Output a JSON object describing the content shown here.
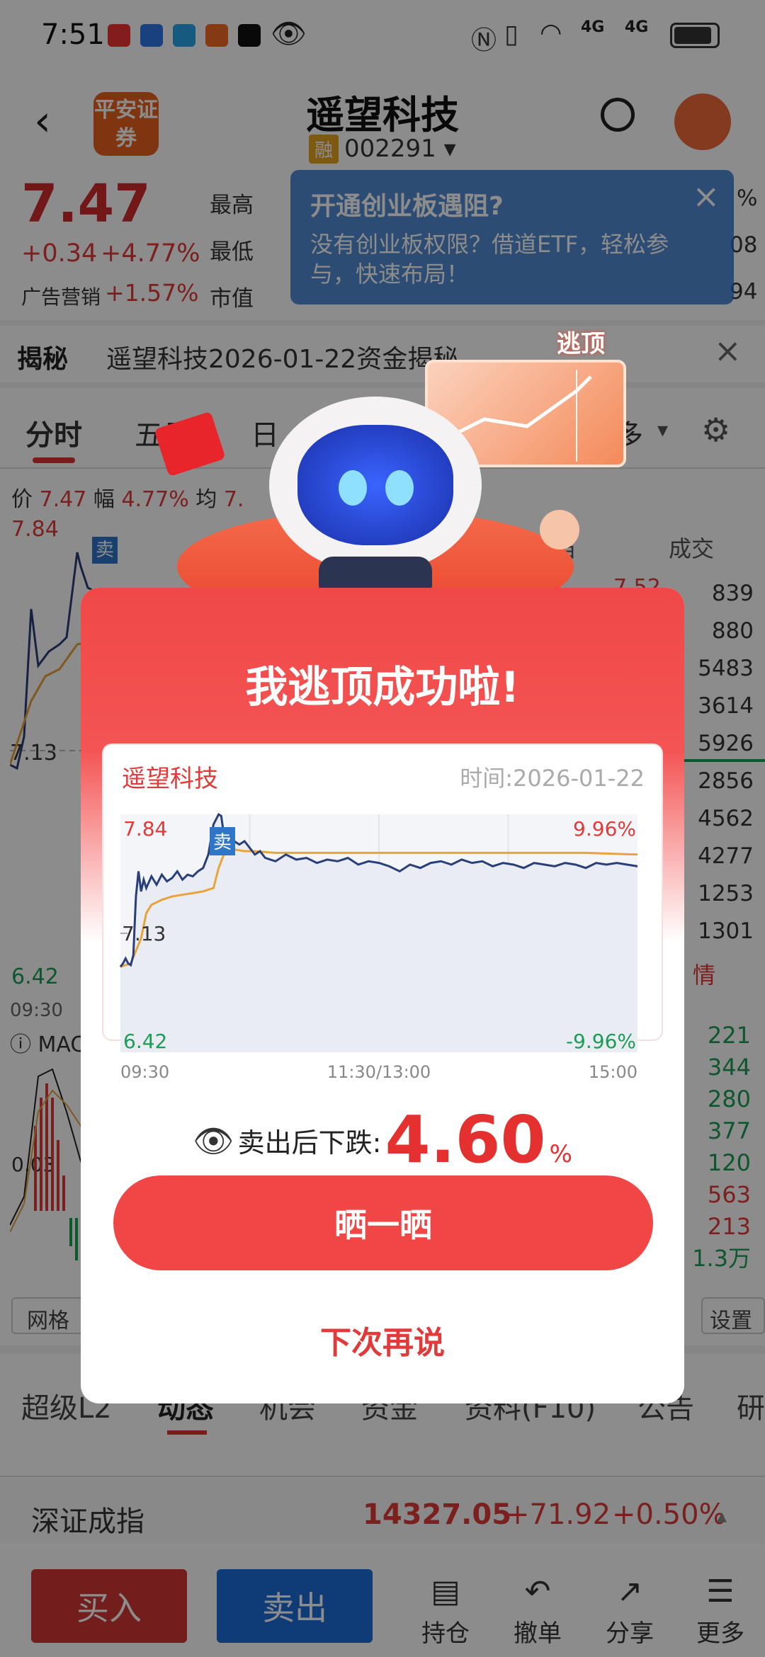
{
  "status": {
    "time": "7:51",
    "signal1": "4G",
    "signal2": "4G"
  },
  "header": {
    "logo_text": "平安证券",
    "stock_name": "遥望科技",
    "badge": "融",
    "code": "002291"
  },
  "quote": {
    "price": "7.47",
    "change": "+0.34",
    "change_pct": "+4.77%",
    "ad_label": "广告营销",
    "ad_pct": "+1.57%",
    "labels": [
      "最高",
      "最低",
      "市值"
    ],
    "right_col": [
      "%",
      "08",
      "94"
    ]
  },
  "notice": {
    "title": "开通创业板遇阻?",
    "body": "没有创业板权限？借道ETF，轻松参与，快速布局！",
    "close": "×"
  },
  "reveal": {
    "label": "揭秘",
    "text": "遥望科技2026-01-22资金揭秘",
    "close": "×"
  },
  "tabs": {
    "items": [
      "分时",
      "五日",
      "日"
    ],
    "more": "多"
  },
  "minibar": {
    "price_label": "价",
    "price": "7.47",
    "amp_label": "幅",
    "amp": "4.77%",
    "avg_label": "均",
    "avg": "7."
  },
  "bg_chart": {
    "top": "7.84",
    "mid": "7.13",
    "bottom": "6.42",
    "time": "09:30",
    "macd": "MAC",
    "macd_val": "0.03",
    "sell_mark": "卖",
    "grid_btn": "网格",
    "set_btn": "设置"
  },
  "orderbook": {
    "headers": [
      "档",
      "成交"
    ],
    "partial_price": "7.52",
    "vols": [
      "839",
      "880",
      "5483",
      "3614",
      "5926",
      "2856",
      "4562",
      "4277",
      "1253",
      "1301"
    ],
    "link": "情"
  },
  "right_nums": [
    "221",
    "344",
    "280",
    "377",
    "120",
    "563",
    "213",
    "1.3万"
  ],
  "bottom_tabs": [
    "超级L2",
    "动态",
    "机会",
    "资金",
    "资料(F10)",
    "公告",
    "研"
  ],
  "index": {
    "name": "深证成指",
    "value": "14327.05",
    "change": "+71.92",
    "pct": "+0.50%"
  },
  "actions": {
    "buy": "买入",
    "sell": "卖出",
    "tools": [
      "持仓",
      "撤单",
      "分享",
      "更多"
    ]
  },
  "banner": {
    "tag": "逃顶"
  },
  "modal": {
    "title": "我逃顶成功啦!",
    "card_name": "遥望科技",
    "card_time": "时间:2026-01-22",
    "share_btn": "晒一晒",
    "later_btn": "下次再说",
    "result_label": "卖出后下跌:",
    "result_value": "4.60",
    "result_unit": "%"
  },
  "chart_data": {
    "type": "line",
    "title": "",
    "ylim": [
      6.42,
      7.84
    ],
    "y_left_labels": [
      "7.84",
      "7.13",
      "6.42"
    ],
    "y_right_labels": [
      "9.96%",
      "-9.96%"
    ],
    "x_labels": [
      "09:30",
      "11:30/13:00",
      "15:00"
    ],
    "sell_marker": {
      "label": "卖",
      "x": 0.2
    },
    "series": [
      {
        "color": "#2a3f7a",
        "x": [
          0,
          0.005,
          0.01,
          0.015,
          0.02,
          0.025,
          0.03,
          0.035,
          0.04,
          0.045,
          0.05,
          0.06,
          0.07,
          0.08,
          0.09,
          0.1,
          0.11,
          0.12,
          0.13,
          0.14,
          0.15,
          0.16,
          0.17,
          0.18,
          0.19,
          0.195,
          0.2,
          0.205,
          0.21,
          0.22,
          0.23,
          0.24,
          0.25,
          0.26,
          0.27,
          0.28,
          0.3,
          0.32,
          0.34,
          0.36,
          0.38,
          0.4,
          0.42,
          0.44,
          0.46,
          0.48,
          0.5,
          0.52,
          0.54,
          0.56,
          0.58,
          0.6,
          0.62,
          0.64,
          0.66,
          0.68,
          0.7,
          0.72,
          0.74,
          0.76,
          0.78,
          0.8,
          0.82,
          0.84,
          0.86,
          0.88,
          0.9,
          0.92,
          0.94,
          0.96,
          0.98,
          1.0
        ],
        "y": [
          6.93,
          6.95,
          6.98,
          6.95,
          6.94,
          7.0,
          7.35,
          7.5,
          7.38,
          7.45,
          7.4,
          7.47,
          7.42,
          7.48,
          7.44,
          7.46,
          7.5,
          7.45,
          7.48,
          7.47,
          7.5,
          7.52,
          7.6,
          7.78,
          7.84,
          7.83,
          7.72,
          7.7,
          7.72,
          7.68,
          7.66,
          7.68,
          7.64,
          7.6,
          7.62,
          7.58,
          7.56,
          7.6,
          7.57,
          7.58,
          7.55,
          7.57,
          7.56,
          7.58,
          7.54,
          7.56,
          7.55,
          7.53,
          7.5,
          7.54,
          7.52,
          7.55,
          7.56,
          7.54,
          7.57,
          7.55,
          7.56,
          7.53,
          7.55,
          7.54,
          7.52,
          7.55,
          7.54,
          7.53,
          7.55,
          7.54,
          7.52,
          7.55,
          7.54,
          7.55,
          7.54,
          7.53
        ]
      },
      {
        "color": "#e8a33a",
        "x": [
          0,
          0.02,
          0.04,
          0.05,
          0.06,
          0.08,
          0.1,
          0.12,
          0.14,
          0.16,
          0.18,
          0.19,
          0.2,
          0.22,
          0.24,
          0.26,
          0.3,
          0.4,
          0.5,
          0.6,
          0.7,
          0.8,
          0.9,
          1.0
        ],
        "y": [
          6.93,
          6.95,
          7.1,
          7.25,
          7.3,
          7.33,
          7.35,
          7.36,
          7.37,
          7.38,
          7.4,
          7.52,
          7.6,
          7.63,
          7.62,
          7.62,
          7.61,
          7.61,
          7.61,
          7.61,
          7.61,
          7.61,
          7.61,
          7.6
        ]
      }
    ]
  }
}
